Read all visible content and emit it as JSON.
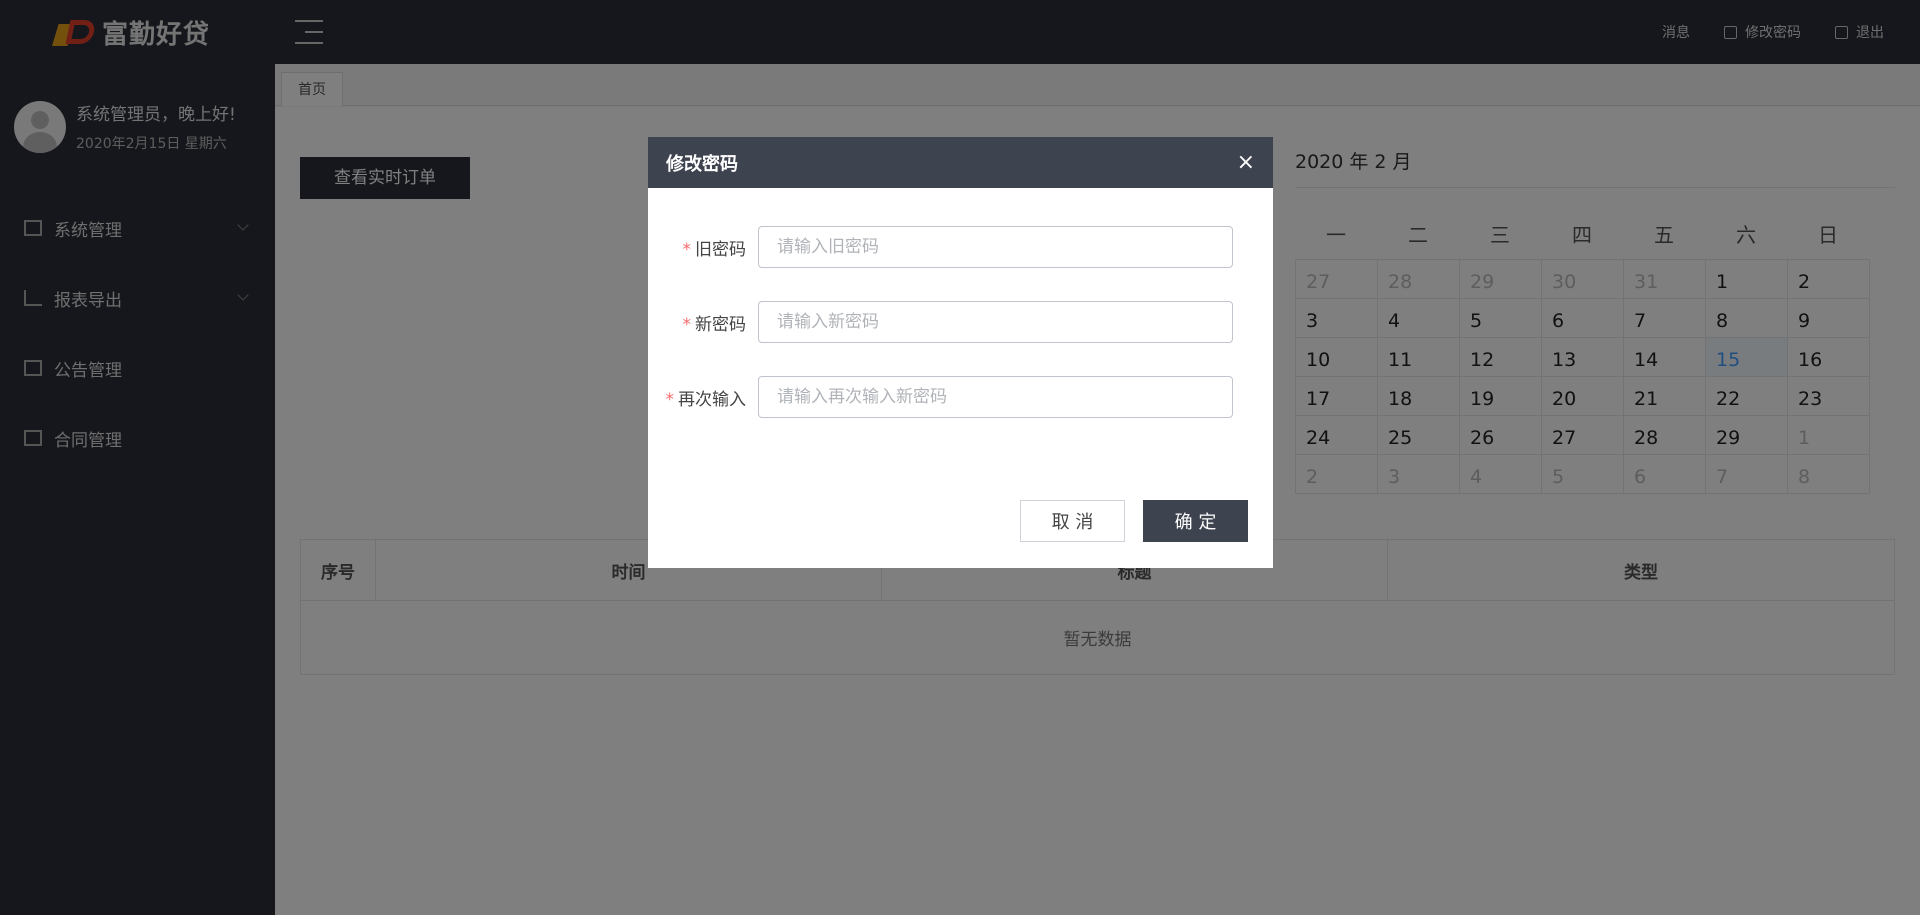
{
  "header": {
    "brand": "富勤好贷",
    "menu_toggle_icon": "menu-fold-icon",
    "actions": [
      {
        "label": "消息",
        "icon": ""
      },
      {
        "label": "修改密码",
        "icon": "lock-icon"
      },
      {
        "label": "退出",
        "icon": "logout-icon"
      }
    ]
  },
  "sidebar": {
    "greeting": "系统管理员，晚上好!",
    "date": "2020年2月15日 星期六",
    "items": [
      {
        "label": "系统管理",
        "icon": "layout-icon",
        "expandable": true
      },
      {
        "label": "报表导出",
        "icon": "chart-icon",
        "expandable": true
      },
      {
        "label": "公告管理",
        "icon": "notice-icon",
        "expandable": false
      },
      {
        "label": "合同管理",
        "icon": "contract-icon",
        "expandable": false
      }
    ]
  },
  "tabs": [
    {
      "label": "首页"
    }
  ],
  "main": {
    "order_button": "查看实时订单",
    "calendar": {
      "title": "2020 年 2 月",
      "weekdays": [
        "一",
        "二",
        "三",
        "四",
        "五",
        "六",
        "日"
      ],
      "days": [
        {
          "d": "27",
          "o": true
        },
        {
          "d": "28",
          "o": true
        },
        {
          "d": "29",
          "o": true
        },
        {
          "d": "30",
          "o": true
        },
        {
          "d": "31",
          "o": true
        },
        {
          "d": "1"
        },
        {
          "d": "2"
        },
        {
          "d": "3"
        },
        {
          "d": "4"
        },
        {
          "d": "5"
        },
        {
          "d": "6"
        },
        {
          "d": "7"
        },
        {
          "d": "8"
        },
        {
          "d": "9"
        },
        {
          "d": "10"
        },
        {
          "d": "11"
        },
        {
          "d": "12"
        },
        {
          "d": "13"
        },
        {
          "d": "14"
        },
        {
          "d": "15",
          "t": true
        },
        {
          "d": "16"
        },
        {
          "d": "17"
        },
        {
          "d": "18"
        },
        {
          "d": "19"
        },
        {
          "d": "20"
        },
        {
          "d": "21"
        },
        {
          "d": "22"
        },
        {
          "d": "23"
        },
        {
          "d": "24"
        },
        {
          "d": "25"
        },
        {
          "d": "26"
        },
        {
          "d": "27"
        },
        {
          "d": "28"
        },
        {
          "d": "29"
        },
        {
          "d": "1",
          "o": true
        },
        {
          "d": "2",
          "o": true
        },
        {
          "d": "3",
          "o": true
        },
        {
          "d": "4",
          "o": true
        },
        {
          "d": "5",
          "o": true
        },
        {
          "d": "6",
          "o": true
        },
        {
          "d": "7",
          "o": true
        },
        {
          "d": "8",
          "o": true
        }
      ]
    },
    "table": {
      "columns": [
        "序号",
        "时间",
        "标题",
        "类型"
      ],
      "empty_text": "暂无数据"
    }
  },
  "dialog": {
    "title": "修改密码",
    "close_label": "×",
    "fields": [
      {
        "label": "旧密码",
        "placeholder": "请输入旧密码",
        "value": ""
      },
      {
        "label": "新密码",
        "placeholder": "请输入新密码",
        "value": ""
      },
      {
        "label": "再次输入",
        "placeholder": "请输入再次输入新密码",
        "value": ""
      }
    ],
    "cancel_label": "取 消",
    "confirm_label": "确 定"
  },
  "colors": {
    "header_bg": "#2a2f38",
    "dialog_header_bg": "#3e4350",
    "required_star": "#f56c6c",
    "today": "#409eff"
  }
}
